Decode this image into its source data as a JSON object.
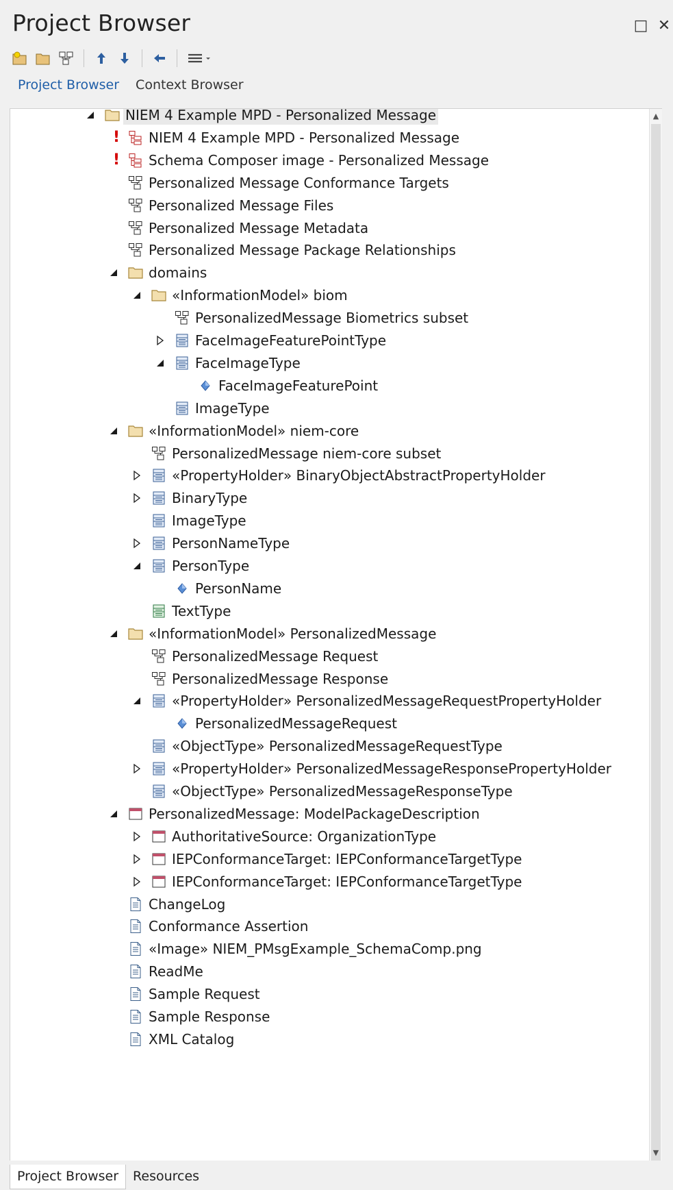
{
  "window": {
    "title": "Project Browser",
    "maximize_glyph": "□",
    "close_glyph": "✕"
  },
  "toolbar": {
    "buttons": [
      "new-package-icon",
      "new-folder-icon",
      "new-diagram-icon",
      "move-up-icon",
      "move-down-icon",
      "back-icon",
      "menu-icon"
    ]
  },
  "tabs_top": [
    {
      "label": "Project Browser",
      "active": true
    },
    {
      "label": "Context Browser",
      "active": false
    }
  ],
  "tree": [
    {
      "label": "NIEM 4 Example MPD - Personalized Message",
      "level": 0,
      "expander": "expanded",
      "icon": "folder",
      "selected": true
    },
    {
      "label": "NIEM 4 Example MPD - Personalized Message",
      "level": 1,
      "expander": "none",
      "icon": "diagram-red",
      "warn": "!"
    },
    {
      "label": "Schema Composer image - Personalized Message",
      "level": 1,
      "expander": "none",
      "icon": "diagram-red",
      "warn": "!"
    },
    {
      "label": "Personalized Message Conformance Targets",
      "level": 1,
      "expander": "none",
      "icon": "diagram"
    },
    {
      "label": "Personalized Message Files",
      "level": 1,
      "expander": "none",
      "icon": "diagram"
    },
    {
      "label": "Personalized Message Metadata",
      "level": 1,
      "expander": "none",
      "icon": "diagram"
    },
    {
      "label": "Personalized Message Package Relationships",
      "level": 1,
      "expander": "none",
      "icon": "diagram"
    },
    {
      "label": "domains",
      "level": 1,
      "expander": "expanded",
      "icon": "folder"
    },
    {
      "label": "«InformationModel» biom",
      "level": 2,
      "expander": "expanded",
      "icon": "folder"
    },
    {
      "label": "PersonalizedMessage Biometrics subset",
      "level": 3,
      "expander": "none",
      "icon": "diagram"
    },
    {
      "label": "FaceImageFeaturePointType",
      "level": 3,
      "expander": "collapsed",
      "icon": "class"
    },
    {
      "label": "FaceImageType",
      "level": 3,
      "expander": "expanded",
      "icon": "class"
    },
    {
      "label": "FaceImageFeaturePoint",
      "level": 4,
      "expander": "none",
      "icon": "property"
    },
    {
      "label": "ImageType",
      "level": 3,
      "expander": "none",
      "icon": "class"
    },
    {
      "label": "«InformationModel» niem-core",
      "level": 1,
      "expander": "expanded",
      "icon": "folder"
    },
    {
      "label": "PersonalizedMessage niem-core subset",
      "level": 2,
      "expander": "none",
      "icon": "diagram"
    },
    {
      "label": "«PropertyHolder» BinaryObjectAbstractPropertyHolder",
      "level": 2,
      "expander": "collapsed",
      "icon": "class"
    },
    {
      "label": "BinaryType",
      "level": 2,
      "expander": "collapsed",
      "icon": "class"
    },
    {
      "label": "ImageType",
      "level": 2,
      "expander": "none",
      "icon": "class"
    },
    {
      "label": "PersonNameType",
      "level": 2,
      "expander": "collapsed",
      "icon": "class"
    },
    {
      "label": "PersonType",
      "level": 2,
      "expander": "expanded",
      "icon": "class"
    },
    {
      "label": "PersonName",
      "level": 3,
      "expander": "none",
      "icon": "property"
    },
    {
      "label": "TextType",
      "level": 2,
      "expander": "none",
      "icon": "class-green"
    },
    {
      "label": "«InformationModel» PersonalizedMessage",
      "level": 1,
      "expander": "expanded",
      "icon": "folder"
    },
    {
      "label": "PersonalizedMessage Request",
      "level": 2,
      "expander": "none",
      "icon": "diagram"
    },
    {
      "label": "PersonalizedMessage Response",
      "level": 2,
      "expander": "none",
      "icon": "diagram"
    },
    {
      "label": "«PropertyHolder» PersonalizedMessageRequestPropertyHolder",
      "level": 2,
      "expander": "expanded",
      "icon": "class"
    },
    {
      "label": "PersonalizedMessageRequest",
      "level": 3,
      "expander": "none",
      "icon": "property"
    },
    {
      "label": "«ObjectType» PersonalizedMessageRequestType",
      "level": 2,
      "expander": "none",
      "icon": "class"
    },
    {
      "label": "«PropertyHolder» PersonalizedMessageResponsePropertyHolder",
      "level": 2,
      "expander": "collapsed",
      "icon": "class"
    },
    {
      "label": "«ObjectType» PersonalizedMessageResponseType",
      "level": 2,
      "expander": "none",
      "icon": "class"
    },
    {
      "label": "PersonalizedMessage: ModelPackageDescription",
      "level": 1,
      "expander": "expanded",
      "icon": "instance"
    },
    {
      "label": "AuthoritativeSource: OrganizationType",
      "level": 2,
      "expander": "collapsed",
      "icon": "instance"
    },
    {
      "label": "IEPConformanceTarget: IEPConformanceTargetType",
      "level": 2,
      "expander": "collapsed",
      "icon": "instance"
    },
    {
      "label": "IEPConformanceTarget: IEPConformanceTargetType",
      "level": 2,
      "expander": "collapsed",
      "icon": "instance"
    },
    {
      "label": "ChangeLog",
      "level": 1,
      "expander": "none",
      "icon": "document"
    },
    {
      "label": "Conformance Assertion",
      "level": 1,
      "expander": "none",
      "icon": "document"
    },
    {
      "label": "«Image» NIEM_PMsgExample_SchemaComp.png",
      "level": 1,
      "expander": "none",
      "icon": "document"
    },
    {
      "label": "ReadMe",
      "level": 1,
      "expander": "none",
      "icon": "document"
    },
    {
      "label": "Sample Request",
      "level": 1,
      "expander": "none",
      "icon": "document"
    },
    {
      "label": "Sample Response",
      "level": 1,
      "expander": "none",
      "icon": "document"
    },
    {
      "label": "XML Catalog",
      "level": 1,
      "expander": "none",
      "icon": "document"
    }
  ],
  "tabs_bottom": [
    {
      "label": "Project Browser",
      "active": true
    },
    {
      "label": "Resources",
      "active": false
    }
  ],
  "colors": {
    "accent": "#1f5ea8",
    "folder": "#e8c27a",
    "warning": "#d40000"
  }
}
